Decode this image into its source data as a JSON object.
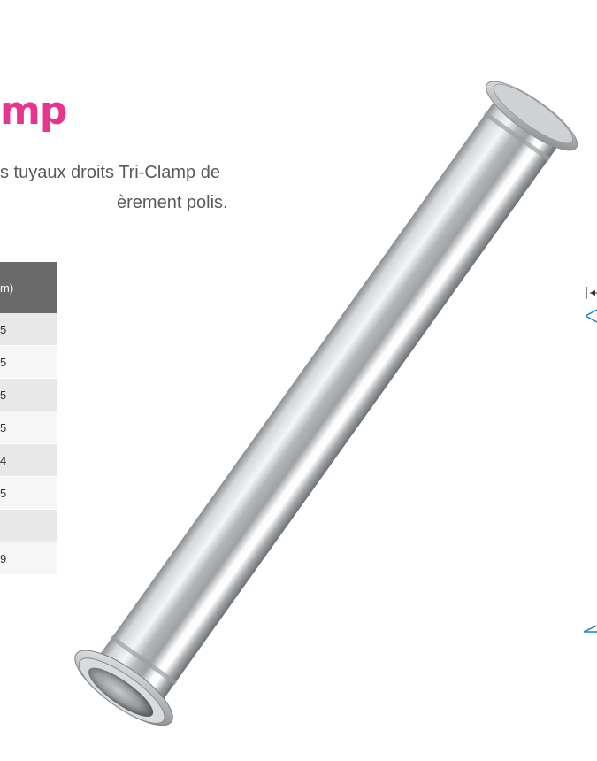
{
  "heading": "mp",
  "description": {
    "line1": "s tuyaux droits Tri-Clamp de",
    "line2": "èrement polis."
  },
  "spec_table": {
    "header": "m)",
    "rows": [
      "5",
      "5",
      "5",
      "5",
      "4",
      "5",
      "",
      "9"
    ]
  },
  "colors": {
    "accent": "#e8338f",
    "table_header": "#6a6a6a",
    "dimension_lines": "#1a7fd1"
  },
  "dimension_marker": "|←"
}
